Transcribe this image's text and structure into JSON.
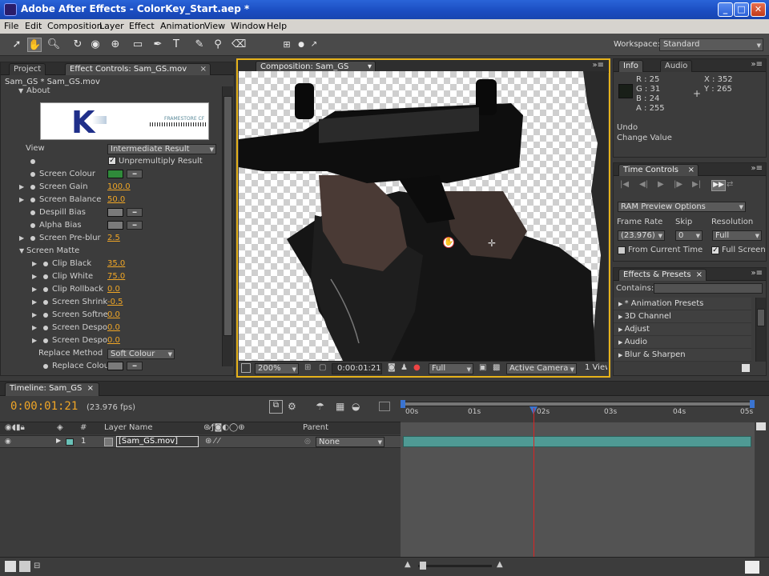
{
  "window": {
    "title": "Adobe After Effects - ColorKey_Start.aep *",
    "minimize": "_",
    "maximize": "□",
    "close": "✕"
  },
  "menu": [
    "File",
    "Edit",
    "Composition",
    "Layer",
    "Effect",
    "Animation",
    "View",
    "Window",
    "Help"
  ],
  "toolbar": {
    "workspace_label": "Workspace:",
    "workspace_value": "Standard",
    "tool_icons": [
      "selection-tool-icon",
      "hand-tool-icon",
      "zoom-tool-icon",
      "rotate-tool-icon",
      "camera-tool-icon",
      "pan-behind-icon",
      "rectangle-mask-icon",
      "pen-tool-icon",
      "type-tool-icon",
      "brush-tool-icon",
      "clone-stamp-icon",
      "eraser-icon"
    ]
  },
  "project_panel": {
    "tabs": [
      "Project",
      "Effect Controls: Sam_GS.mov"
    ],
    "breadcrumb": "Sam_GS * Sam_GS.mov",
    "about_label": "About",
    "logo_letter": "K",
    "logo_text": "FRAMESTORE CF",
    "view_label": "View",
    "view_value": "Intermediate Result",
    "unpremultiply": "Unpremultiply Result",
    "rows": [
      {
        "label": "Screen Colour",
        "type": "swatch",
        "color": "#2f8a3a"
      },
      {
        "label": "Screen Gain",
        "value": "100.0"
      },
      {
        "label": "Screen Balance",
        "value": "50.0"
      },
      {
        "label": "Despill Bias",
        "type": "swatch",
        "color": "#7a7a7a"
      },
      {
        "label": "Alpha Bias",
        "type": "swatch",
        "color": "#7a7a7a"
      },
      {
        "label": "Screen Pre-blur",
        "value": "2.5"
      }
    ],
    "screen_matte_label": "Screen Matte",
    "matte_rows": [
      {
        "label": "Clip Black",
        "value": "35.0"
      },
      {
        "label": "Clip White",
        "value": "75.0"
      },
      {
        "label": "Clip Rollback",
        "value": "0.0"
      },
      {
        "label": "Screen Shrink",
        "value": "-0.5"
      },
      {
        "label": "Screen Softne",
        "value": "0.0"
      },
      {
        "label": "Screen Despo",
        "value": "0.0"
      },
      {
        "label": "Screen Despo",
        "value": "0.0"
      }
    ],
    "replace_method_label": "Replace Method",
    "replace_method_value": "Soft Colour",
    "replace_colour_label": "Replace Colou"
  },
  "composition": {
    "tab": "Composition: Sam_GS",
    "zoom": "200%",
    "timecode": "0:00:01:21",
    "resolution": "Full",
    "camera": "Active Camera",
    "view": "1 View"
  },
  "info_panel": {
    "tabs": [
      "Info",
      "Audio"
    ],
    "r": "R : 25",
    "g": "G : 31",
    "b": "B : 24",
    "a": "A : 255",
    "x": "X : 352",
    "y": "Y : 265",
    "undo": "Undo",
    "change_value": "Change Value"
  },
  "time_controls": {
    "tab": "Time Controls",
    "ram_preview": "RAM Preview Options",
    "frame_rate_label": "Frame Rate",
    "skip_label": "Skip",
    "resolution_label": "Resolution",
    "frame_rate_value": "(23.976)",
    "skip_value": "0",
    "resolution_value": "Full",
    "from_current": "From Current Time",
    "full_screen": "Full Screen"
  },
  "effects_presets": {
    "tab": "Effects & Presets",
    "contains_label": "Contains:",
    "items": [
      "* Animation Presets",
      "3D Channel",
      "Adjust",
      "Audio",
      "Blur & Sharpen"
    ]
  },
  "timeline": {
    "tab": "Timeline: Sam_GS",
    "timecode": "0:00:01:21",
    "fps": "(23.976 fps)",
    "col_num": "#",
    "col_layer": "Layer Name",
    "col_parent": "Parent",
    "ruler": [
      "00s",
      "01s",
      "02s",
      "03s",
      "04s",
      "05s"
    ],
    "layer": {
      "index": "1",
      "name": "[Sam_GS.mov]",
      "parent": "None"
    },
    "layer_color": "#4f9a94"
  }
}
